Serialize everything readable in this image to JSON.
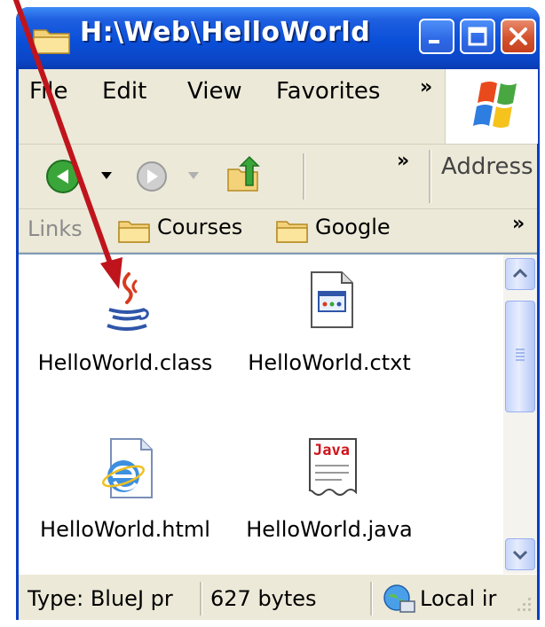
{
  "window": {
    "title": "H:\\Web\\HelloWorld"
  },
  "menu": {
    "items": [
      "File",
      "Edit",
      "View",
      "Favorites"
    ],
    "overflow": "»"
  },
  "toolbar": {
    "overflow": "»",
    "address_label": "Address"
  },
  "links": {
    "label": "Links",
    "items": [
      "Courses",
      "Google"
    ],
    "overflow": "»"
  },
  "files": [
    {
      "name": "HelloWorld.class",
      "icon": "java-coffee-cup-icon"
    },
    {
      "name": "HelloWorld.ctxt",
      "icon": "text-document-icon"
    },
    {
      "name": "HelloWorld.html",
      "icon": "internet-explorer-document-icon"
    },
    {
      "name": "HelloWorld.java",
      "icon": "java-source-document-icon"
    }
  ],
  "statusbar": {
    "type": "Type: BlueJ pr",
    "size": "627 bytes",
    "zone": "Local ir"
  },
  "colors": {
    "titlebar": "#0a4fd8",
    "annotation_arrow": "#c0141c"
  }
}
